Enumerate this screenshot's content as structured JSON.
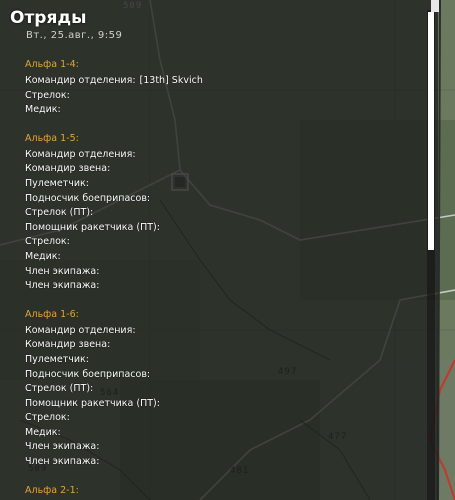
{
  "panel": {
    "title": "Отряды",
    "datetime": "Вт., 25.авг.,  9:59"
  },
  "groups": [
    {
      "name": "Альфа 1-4:",
      "roles": [
        {
          "role": "Командир отделения:",
          "player": "[13th] Skvich"
        },
        {
          "role": "Стрелок:",
          "player": ""
        },
        {
          "role": "Медик:",
          "player": ""
        }
      ]
    },
    {
      "name": "Альфа 1-5:",
      "roles": [
        {
          "role": "Командир отделения:",
          "player": ""
        },
        {
          "role": "Командир звена:",
          "player": ""
        },
        {
          "role": "Пулеметчик:",
          "player": ""
        },
        {
          "role": "Подносчик боеприпасов:",
          "player": ""
        },
        {
          "role": "Стрелок (ПТ):",
          "player": ""
        },
        {
          "role": "Помощник ракетчика (ПТ):",
          "player": ""
        },
        {
          "role": "Стрелок:",
          "player": ""
        },
        {
          "role": "Медик:",
          "player": ""
        },
        {
          "role": "Член экипажа:",
          "player": ""
        },
        {
          "role": "Член экипажа:",
          "player": ""
        }
      ]
    },
    {
      "name": "Альфа 1-6:",
      "roles": [
        {
          "role": "Командир отделения:",
          "player": ""
        },
        {
          "role": "Командир звена:",
          "player": ""
        },
        {
          "role": "Пулеметчик:",
          "player": ""
        },
        {
          "role": "Подносчик боеприпасов:",
          "player": ""
        },
        {
          "role": "Стрелок (ПТ):",
          "player": ""
        },
        {
          "role": "Помощник ракетчика (ПТ):",
          "player": ""
        },
        {
          "role": "Стрелок:",
          "player": ""
        },
        {
          "role": "Медик:",
          "player": ""
        },
        {
          "role": "Член экипажа:",
          "player": ""
        },
        {
          "role": "Член экипажа:",
          "player": ""
        }
      ]
    },
    {
      "name": "Альфа 2-1:",
      "roles": []
    }
  ],
  "map": {
    "labels": [
      "509",
      "497",
      "477",
      "481",
      "564",
      "509"
    ]
  },
  "colors": {
    "group_name": "#e0a43c",
    "panel_bg": "rgba(30,32,30,0.80)",
    "road": "#c8c8c8",
    "river": "#c0392b"
  }
}
